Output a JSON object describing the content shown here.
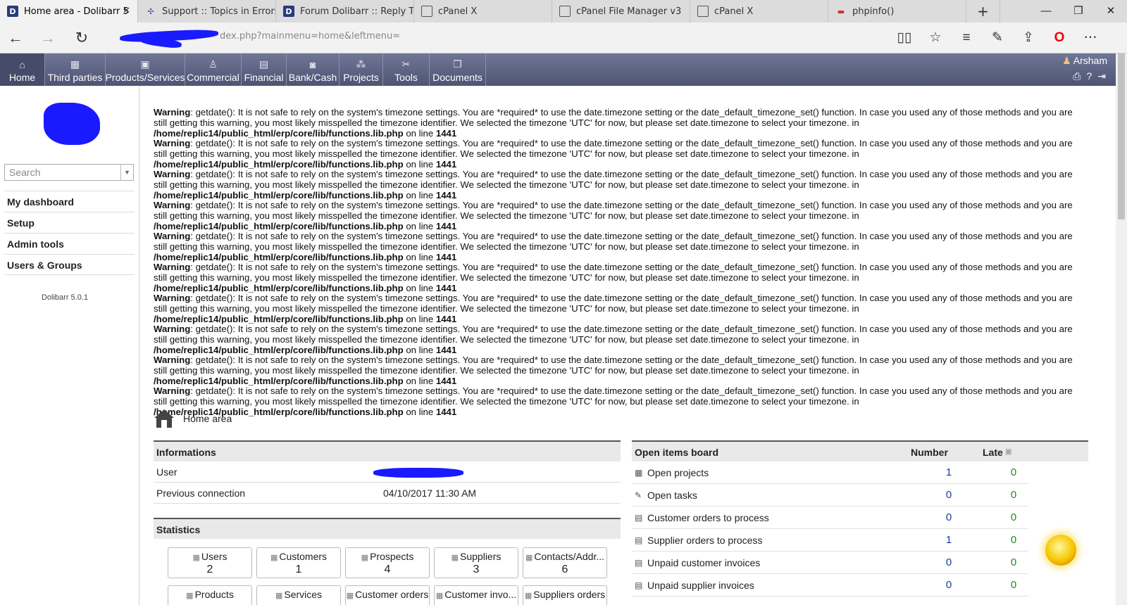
{
  "browser": {
    "tabs": [
      {
        "title": "Home area - Dolibarr 5",
        "icon": "dolibarr-icon",
        "active": true
      },
      {
        "title": "Support :: Topics in Errors /",
        "icon": "forum-icon"
      },
      {
        "title": "Forum Dolibarr :: Reply Top",
        "icon": "dolibarr-icon"
      },
      {
        "title": "cPanel X",
        "icon": "page-icon"
      },
      {
        "title": "cPanel File Manager v3",
        "icon": "page-icon"
      },
      {
        "title": "cPanel X",
        "icon": "page-icon"
      },
      {
        "title": "phpinfo()",
        "icon": "php-icon"
      }
    ],
    "new_tab": "+",
    "tab_close": "✕",
    "window_controls": {
      "minimize": "—",
      "restore": "❐",
      "close": "✕"
    },
    "nav": {
      "back": "←",
      "forward": "→",
      "refresh": "↻"
    },
    "url": "dex.php?mainmenu=home&leftmenu="
  },
  "topmenu": {
    "items": [
      {
        "label": "Home",
        "icon": "home-icon",
        "glyph": "⌂"
      },
      {
        "label": "Third parties",
        "icon": "building-icon",
        "glyph": "▦"
      },
      {
        "label": "Products/Services",
        "icon": "box-icon",
        "glyph": "▣"
      },
      {
        "label": "Commercial",
        "icon": "person-icon",
        "glyph": "♙"
      },
      {
        "label": "Financial",
        "icon": "money-icon",
        "glyph": "▤"
      },
      {
        "label": "Bank/Cash",
        "icon": "bank-icon",
        "glyph": "◙"
      },
      {
        "label": "Projects",
        "icon": "project-icon",
        "glyph": "⁂"
      },
      {
        "label": "Tools",
        "icon": "tools-icon",
        "glyph": "✂"
      },
      {
        "label": "Documents",
        "icon": "documents-icon",
        "glyph": "❐"
      }
    ],
    "user": "Arsham"
  },
  "leftpanel": {
    "search_placeholder": "Search",
    "menu": [
      "My dashboard",
      "Setup",
      "Admin tools",
      "Users & Groups"
    ],
    "version": "Dolibarr 5.0.1"
  },
  "warning": {
    "label": "Warning",
    "text": ": getdate(): It is not safe to rely on the system's timezone settings. You are *required* to use the date.timezone setting or the date_default_timezone_set() function. In case you used any of those methods and you are still getting this warning, you most likely misspelled the timezone identifier. We selected the timezone 'UTC' for now, but please set date.timezone to select your timezone. in ",
    "path": "/home/replic14/public_html/erp/core/lib/functions.lib.php",
    "on_line": " on line ",
    "line": "1441",
    "count": 10
  },
  "page_title": "Home area",
  "informations": {
    "title": "Informations",
    "rows": [
      {
        "label": "User",
        "value": ""
      },
      {
        "label": "Previous connection",
        "value": "04/10/2017 11:30 AM"
      }
    ]
  },
  "statistics": {
    "title": "Statistics",
    "boxes": [
      {
        "label": "Users",
        "value": "2"
      },
      {
        "label": "Customers",
        "value": "1"
      },
      {
        "label": "Prospects",
        "value": "4"
      },
      {
        "label": "Suppliers",
        "value": "3"
      },
      {
        "label": "Contacts/Addr...",
        "value": "6"
      },
      {
        "label": "Products",
        "value": ""
      },
      {
        "label": "Services",
        "value": ""
      },
      {
        "label": "Customer orders",
        "value": ""
      },
      {
        "label": "Customer invo...",
        "value": ""
      },
      {
        "label": "Suppliers orders",
        "value": ""
      }
    ]
  },
  "open_items": {
    "title": "Open items board",
    "col_number": "Number",
    "col_late": "Late",
    "rows": [
      {
        "label": "Open projects",
        "number": "1",
        "late": "0"
      },
      {
        "label": "Open tasks",
        "number": "0",
        "late": "0"
      },
      {
        "label": "Customer orders to process",
        "number": "0",
        "late": "0"
      },
      {
        "label": "Supplier orders to process",
        "number": "1",
        "late": "0"
      },
      {
        "label": "Unpaid customer invoices",
        "number": "0",
        "late": "0"
      },
      {
        "label": "Unpaid supplier invoices",
        "number": "0",
        "late": "0"
      }
    ]
  }
}
